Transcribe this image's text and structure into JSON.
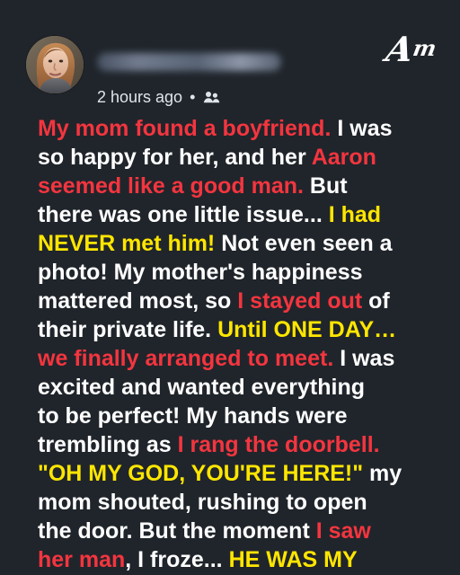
{
  "post": {
    "brand": {
      "logo_text": "Am",
      "icon": "brightside-logo"
    },
    "author": {
      "avatar_icon": "person-avatar",
      "name_visible": false
    },
    "meta": {
      "timestamp": "2 hours ago",
      "separator": "•",
      "audience_icon": "friends-icon"
    },
    "story_lines": [
      [
        {
          "text": "My mom found a boyfriend.",
          "color": "red"
        },
        {
          "text": " I was",
          "color": "white"
        }
      ],
      [
        {
          "text": "so happy for her, and her ",
          "color": "white"
        },
        {
          "text": "Aaron",
          "color": "red"
        }
      ],
      [
        {
          "text": "seemed like a good man.",
          "color": "red"
        },
        {
          "text": " But",
          "color": "white"
        }
      ],
      [
        {
          "text": "there was one little issue... ",
          "color": "white"
        },
        {
          "text": "I had",
          "color": "yellow"
        }
      ],
      [
        {
          "text": "NEVER met him!",
          "color": "yellow"
        },
        {
          "text": " Not even seen a",
          "color": "white"
        }
      ],
      [
        {
          "text": "photo! My mother's happiness",
          "color": "white"
        }
      ],
      [
        {
          "text": "mattered most, so ",
          "color": "white"
        },
        {
          "text": "I stayed out",
          "color": "red"
        },
        {
          "text": " of",
          "color": "white"
        }
      ],
      [
        {
          "text": "their private life. ",
          "color": "white"
        },
        {
          "text": "Until ONE DAY…",
          "color": "yellow"
        }
      ],
      [
        {
          "text": "we finally arranged to meet.",
          "color": "red"
        },
        {
          "text": " I was",
          "color": "white"
        }
      ],
      [
        {
          "text": "excited and wanted everything",
          "color": "white"
        }
      ],
      [
        {
          "text": "to be perfect! My hands were",
          "color": "white"
        }
      ],
      [
        {
          "text": "trembling as ",
          "color": "white"
        },
        {
          "text": "I rang the doorbell.",
          "color": "red"
        }
      ],
      [
        {
          "text": "\"OH MY GOD, YOU'RE HERE!\"",
          "color": "yellow"
        },
        {
          "text": " my",
          "color": "white"
        }
      ],
      [
        {
          "text": "mom shouted, rushing to open",
          "color": "white"
        }
      ],
      [
        {
          "text": "the door. But the moment ",
          "color": "white"
        },
        {
          "text": "I saw",
          "color": "red"
        }
      ],
      [
        {
          "text": "her man",
          "color": "red"
        },
        {
          "text": ", I froze... ",
          "color": "white"
        },
        {
          "text": "HE WAS MY",
          "color": "yellow"
        }
      ]
    ]
  }
}
